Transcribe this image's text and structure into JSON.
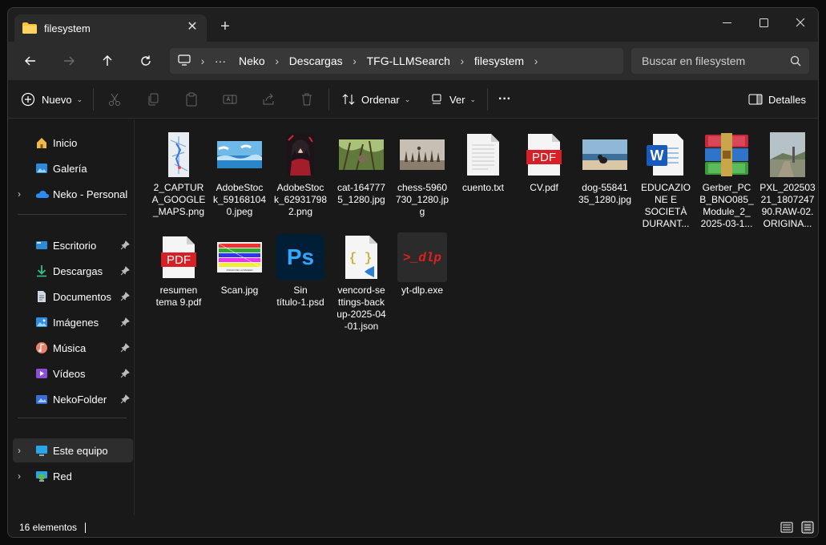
{
  "tab": {
    "title": "filesystem",
    "close_label": "✕",
    "new_label": "+"
  },
  "window_controls": {
    "minimize": "—",
    "maximize": "☐",
    "close": "✕"
  },
  "breadcrumbs": [
    "Neko",
    "Descargas",
    "TFG-LLMSearch",
    "filesystem"
  ],
  "breadcrumb_more": "···",
  "search": {
    "placeholder": "Buscar en filesystem"
  },
  "toolbar": {
    "new_label": "Nuevo",
    "sort_label": "Ordenar",
    "view_label": "Ver",
    "more_label": "···",
    "details_label": "Detalles"
  },
  "sidebar": {
    "items": [
      {
        "label": "Inicio",
        "icon": "home-icon"
      },
      {
        "label": "Galería",
        "icon": "gallery-icon"
      },
      {
        "label": "Neko - Personal",
        "icon": "onedrive-icon"
      },
      {
        "label": "Escritorio",
        "icon": "desktop-icon"
      },
      {
        "label": "Descargas",
        "icon": "download-icon"
      },
      {
        "label": "Documentos",
        "icon": "documents-icon"
      },
      {
        "label": "Imágenes",
        "icon": "pictures-icon"
      },
      {
        "label": "Música",
        "icon": "music-icon"
      },
      {
        "label": "Vídeos",
        "icon": "videos-icon"
      },
      {
        "label": "NekoFolder",
        "icon": "folder-icon"
      },
      {
        "label": "Este equipo",
        "icon": "computer-icon"
      },
      {
        "label": "Red",
        "icon": "network-icon"
      }
    ]
  },
  "files": [
    {
      "name": "2_CAPTURA_GOOGLE_MAPS.png",
      "display": [
        "2_CAPTUR",
        "A_GOOGLE",
        "_MAPS.png"
      ]
    },
    {
      "name": "AdobeStock_591681040.jpeg",
      "display": [
        "AdobeStoc",
        "k_59168104",
        "0.jpeg"
      ]
    },
    {
      "name": "AdobeStock_629317982.png",
      "display": [
        "AdobeStoc",
        "k_62931798",
        "2.png"
      ]
    },
    {
      "name": "cat-1647775_1280.jpg",
      "display": [
        "cat-164777",
        "5_1280.jpg"
      ]
    },
    {
      "name": "chess-5960730_1280.jpg",
      "display": [
        "chess-5960",
        "730_1280.jp",
        "g"
      ]
    },
    {
      "name": "cuento.txt",
      "display": [
        "cuento.txt"
      ]
    },
    {
      "name": "CV.pdf",
      "display": [
        "CV.pdf"
      ]
    },
    {
      "name": "dog-5584135_1280.jpg",
      "display": [
        "dog-55841",
        "35_1280.jpg"
      ]
    },
    {
      "name": "EDUCAZIONE E SOCIETÀ DURANT...",
      "display": [
        "EDUCAZIO",
        "NE E",
        "SOCIETÀ",
        "DURANT..."
      ]
    },
    {
      "name": "Gerber_PCB_BNO085_Module_2_2025-03-1...",
      "display": [
        "Gerber_PC",
        "B_BNO085_",
        "Module_2_",
        "2025-03-1..."
      ]
    },
    {
      "name": "PXL_20250321_180724790.RAW-02.ORIGINA...",
      "display": [
        "PXL_202503",
        "21_1807247",
        "90.RAW-02.",
        "ORIGINA..."
      ]
    },
    {
      "name": "resumen tema 9.pdf",
      "display": [
        "resumen",
        "tema 9.pdf"
      ]
    },
    {
      "name": "Scan.jpg",
      "display": [
        "Scan.jpg"
      ]
    },
    {
      "name": "Sin título-1.psd",
      "display": [
        "Sin",
        "título-1.psd"
      ]
    },
    {
      "name": "vencord-settings-backup-2025-04-01.json",
      "display": [
        "vencord-se",
        "ttings-back",
        "up-2025-04",
        "-01.json"
      ]
    },
    {
      "name": "yt-dlp.exe",
      "display": [
        "yt-dlp.exe"
      ]
    }
  ],
  "thumb_text": {
    "pdf": "PDF",
    "ps": "Ps",
    "json": "{ }",
    "dlp": ">_dlp",
    "word": "W",
    "tiny": "ANCHO DE LA IMAGEN"
  },
  "status": {
    "count": "16 elementos"
  },
  "colors": {
    "accent": "#4cc2ff",
    "pdf_red": "#d81f26",
    "ps_blue": "#31a8ff"
  }
}
